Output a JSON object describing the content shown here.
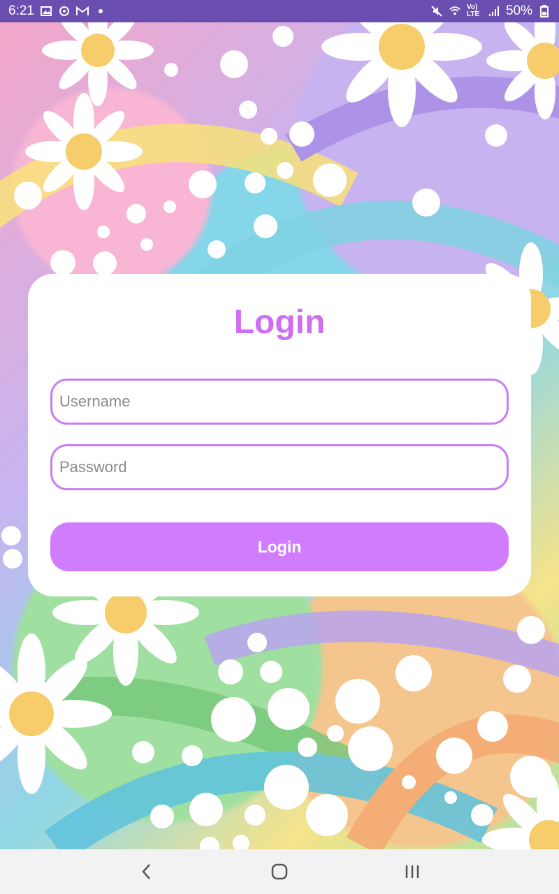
{
  "status_bar": {
    "time": "6:21",
    "battery": "50%",
    "network_label": "Vo) LTE",
    "left_icons": [
      "image-icon",
      "sync-icon",
      "gmail-icon",
      "dot-icon"
    ],
    "right_icons": [
      "mute-icon",
      "wifi-icon",
      "signal-icon",
      "battery-icon"
    ]
  },
  "login": {
    "title": "Login",
    "username_placeholder": "Username",
    "password_placeholder": "Password",
    "button_label": "Login"
  },
  "nav_bar": {
    "buttons": [
      "back-icon",
      "home-icon",
      "recents-icon"
    ]
  },
  "colors": {
    "status_bar": "#6a4fb0",
    "accent": "#d17cfc",
    "field_border": "#c97ef0",
    "title": "#cf6ef3"
  }
}
